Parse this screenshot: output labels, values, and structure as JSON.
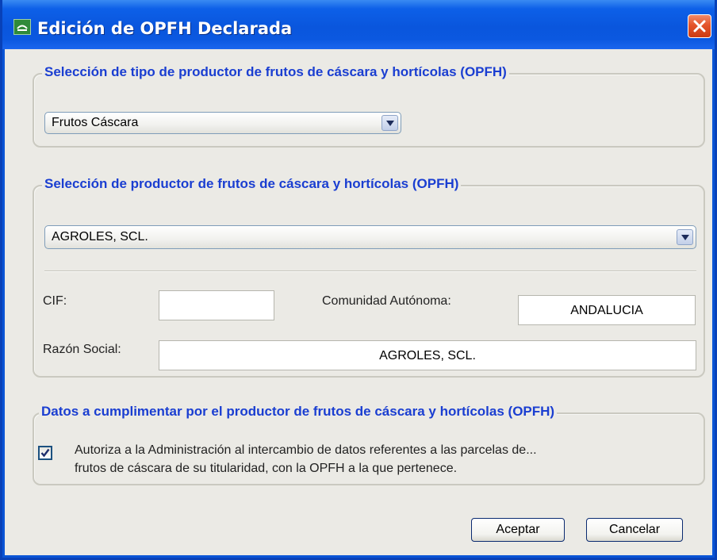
{
  "window": {
    "title": "Edición de OPFH Declarada",
    "icon": "junta-andalucia-logo-icon",
    "colors": {
      "titlebar": "#0a56dd",
      "legend": "#1a3ed1",
      "close": "#e4542a",
      "client": "#ebeae5"
    }
  },
  "tipo_productor": {
    "legend": "Selección de tipo de productor de frutos de cáscara y hortícolas (OPFH)",
    "selected": "Frutos Cáscara"
  },
  "productor": {
    "legend": "Selección de productor de frutos de cáscara y hortícolas (OPFH)",
    "selected": "AGROLES, SCL.",
    "cif_label": "CIF:",
    "cif_value": "",
    "comunidad_label": "Comunidad Autónoma:",
    "comunidad_value": "ANDALUCIA",
    "razon_label": "Razón Social:",
    "razon_value": "AGROLES, SCL."
  },
  "datos": {
    "legend": "Datos a cumplimentar por el productor de frutos de cáscara y hortícolas (OPFH)",
    "checked": true,
    "checkbox_line1": "Autoriza a la Administración al intercambio de datos referentes a las parcelas de...",
    "checkbox_line2": "frutos de cáscara de su titularidad, con la OPFH a la que pertenece."
  },
  "buttons": {
    "accept": "Aceptar",
    "cancel": "Cancelar"
  }
}
